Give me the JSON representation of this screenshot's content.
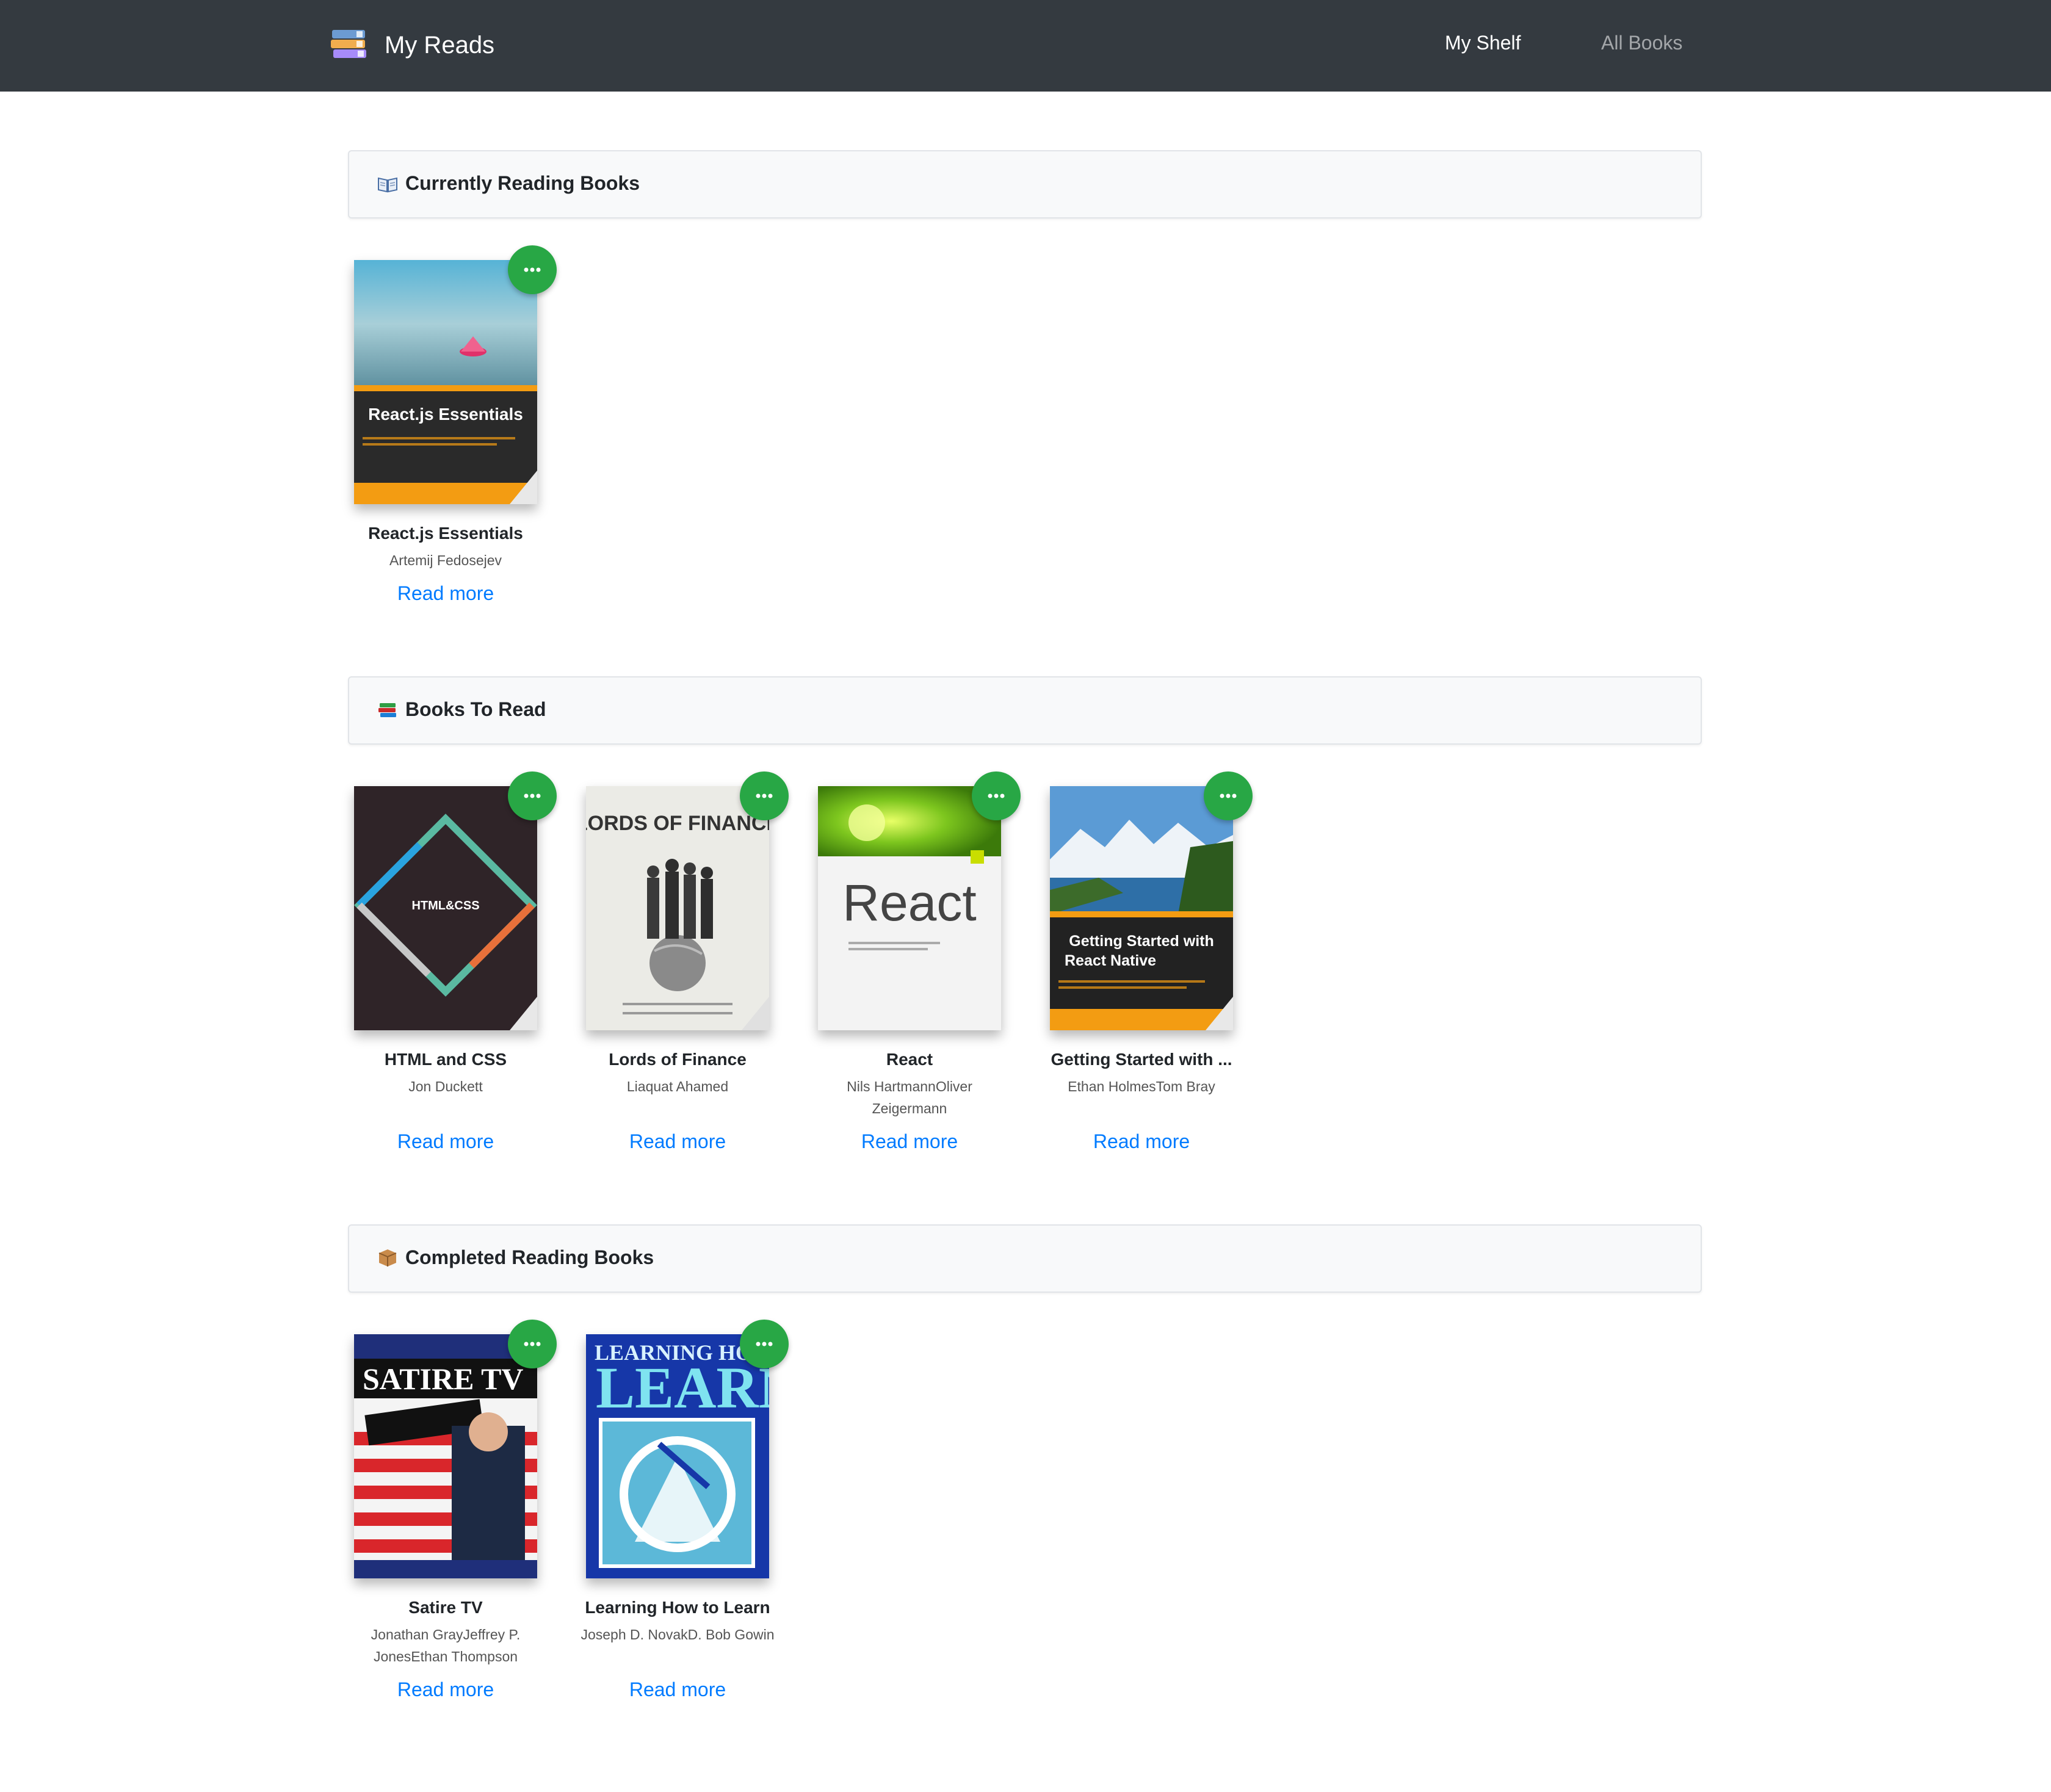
{
  "app": {
    "title": "My Reads",
    "nav": {
      "my_shelf": "My Shelf",
      "all_books": "All Books"
    }
  },
  "colors": {
    "navbar": "#343a40",
    "menu_button": "#28a745",
    "link": "#007bff",
    "shelf_header_bg": "#f8f9fa"
  },
  "shelves": [
    {
      "title": "Currently Reading Books",
      "icon": "open-book-icon",
      "books": [
        {
          "title": "React.js Essentials",
          "author": "Artemij Fedosejev",
          "read_more": "Read more",
          "cover_text": "React.js Essentials"
        }
      ]
    },
    {
      "title": "Books To Read",
      "icon": "books-stack-icon",
      "books": [
        {
          "title": "HTML and CSS",
          "author": "Jon Duckett",
          "read_more": "Read more",
          "cover_text": "HTML&CSS"
        },
        {
          "title": "Lords of Finance",
          "author": "Liaquat Ahamed",
          "read_more": "Read more",
          "cover_text": "LORDS OF FINANCE"
        },
        {
          "title": "React",
          "author": "Nils HartmannOliver Zeigermann",
          "read_more": "Read more",
          "cover_text": "React"
        },
        {
          "title": "Getting Started with ...",
          "author": "Ethan HolmesTom Bray",
          "read_more": "Read more",
          "cover_text": "Getting Started with React Native"
        }
      ]
    },
    {
      "title": "Completed Reading Books",
      "icon": "package-icon",
      "books": [
        {
          "title": "Satire TV",
          "author": "Jonathan GrayJeffrey P. JonesEthan Thompson",
          "read_more": "Read more",
          "cover_text": "SATIRE TV"
        },
        {
          "title": "Learning How to Learn",
          "author": "Joseph D. NovakD. Bob Gowin",
          "read_more": "Read more",
          "cover_text": "LEARNING HOW LEARN"
        }
      ]
    }
  ]
}
